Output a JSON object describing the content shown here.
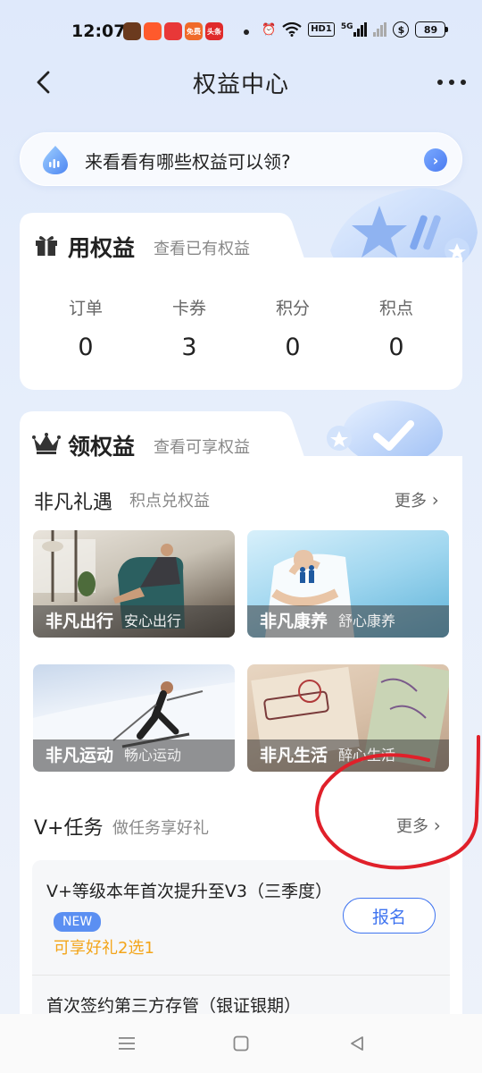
{
  "status_bar": {
    "time": "12:07",
    "app_icons": [
      {
        "name": "app-icon-1",
        "color": "#6b3a1e",
        "text": ""
      },
      {
        "name": "app-icon-2",
        "color": "#ff5a2c",
        "text": ""
      },
      {
        "name": "app-icon-3",
        "color": "#e83838",
        "text": ""
      },
      {
        "name": "app-icon-4",
        "color": "#f06a2a",
        "text": "免费"
      },
      {
        "name": "app-icon-5",
        "color": "#e02a2a",
        "text": "头条"
      }
    ],
    "hd": "HD1",
    "network": "5G",
    "battery": "89"
  },
  "header": {
    "title": "权益中心"
  },
  "ask_bar": {
    "text": "来看看有哪些权益可以领?"
  },
  "use_card": {
    "title": "用权益",
    "subtitle": "查看已有权益",
    "stats": [
      {
        "label": "订单",
        "value": "0"
      },
      {
        "label": "卡券",
        "value": "3"
      },
      {
        "label": "积分",
        "value": "0"
      },
      {
        "label": "积点",
        "value": "0"
      }
    ]
  },
  "get_card": {
    "title": "领权益",
    "subtitle": "查看可享权益",
    "gifts": {
      "title": "非凡礼遇",
      "subtitle": "积点兑权益",
      "more": "更多",
      "tiles": [
        {
          "name": "非凡出行",
          "desc": "安心出行"
        },
        {
          "name": "非凡康养",
          "desc": "舒心康养"
        },
        {
          "name": "非凡运动",
          "desc": "畅心运动"
        },
        {
          "name": "非凡生活",
          "desc": "醉心生活"
        }
      ]
    },
    "tasks": {
      "title": "V+任务",
      "subtitle": "做任务享好礼",
      "more": "更多",
      "items": [
        {
          "title": "V+等级本年首次提升至V3（三季度）",
          "badge": "NEW",
          "reward": "可享好礼2选1",
          "button": "报名"
        },
        {
          "title": "首次签约第三方存管（银证银期）"
        }
      ]
    }
  },
  "colors": {
    "accent": "#3f74f0",
    "reward": "#f3a51a",
    "annotation": "#e0202a"
  }
}
